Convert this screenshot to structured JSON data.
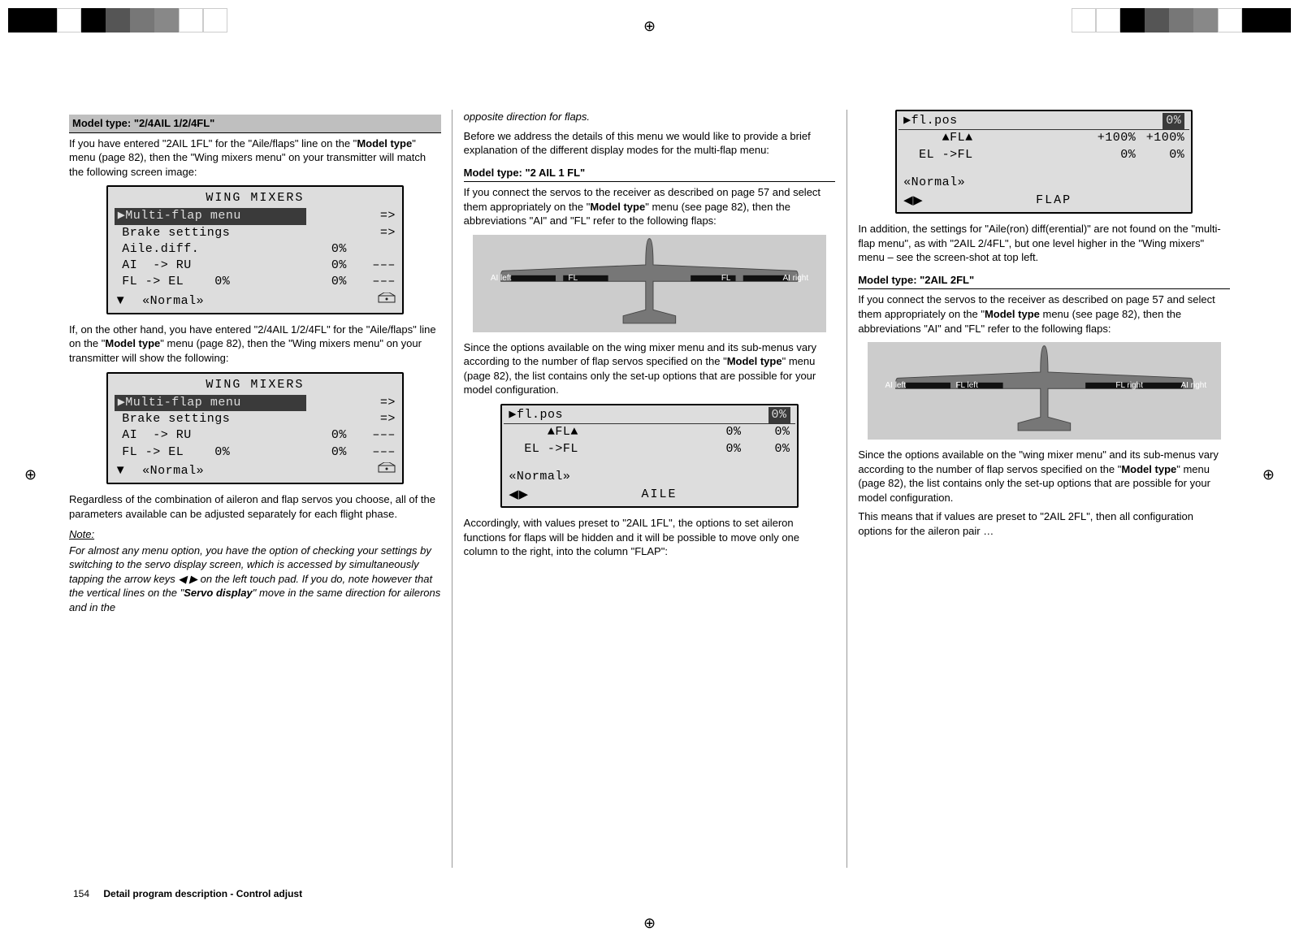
{
  "page_number": "154",
  "footer_text": "Detail program description - Control adjust",
  "col1": {
    "header_bg": "Model type: \"2/4AIL 1/2/4FL\"",
    "p1_a": "If you have entered \"2AIL 1FL\" for the \"Aile/flaps\" line on the \"",
    "p1_b": "Model type",
    "p1_c": "\" menu (page 82), then the \"Wing mixers menu\" on your transmitter will match the following screen image:",
    "lcd1_title": "WING  MIXERS",
    "lcd1_rows": [
      {
        "label": "▶Multi-flap menu",
        "c1": "",
        "c2": "=>"
      },
      {
        "label": " Brake settings",
        "c1": "",
        "c2": "=>"
      },
      {
        "label": " Aile.diff.",
        "c1": "0%",
        "c2": ""
      },
      {
        "label": " AI  -> RU",
        "c1": "0%",
        "c2": "–––"
      },
      {
        "label": " FL -> EL    0%",
        "c1": "0%",
        "c2": "–––"
      }
    ],
    "lcd1_footer_left": "▼",
    "lcd1_footer_mid": "«Normal»",
    "lcd1_footer_right_icon": "icon",
    "p2_a": "If, on the other hand, you have entered \"2/4AIL 1/2/4FL\" for the \"Aile/flaps\" line on the \"",
    "p2_b": "Model type",
    "p2_c": "\" menu (page 82), then the \"Wing mixers menu\" on your transmitter will show the following:",
    "lcd2_title": "WING  MIXERS",
    "lcd2_rows": [
      {
        "label": "▶Multi-flap menu",
        "c1": "",
        "c2": "=>"
      },
      {
        "label": " Brake settings",
        "c1": "",
        "c2": "=>"
      },
      {
        "label": " AI  -> RU",
        "c1": "0%",
        "c2": "–––"
      },
      {
        "label": " FL -> EL    0%",
        "c1": "0%",
        "c2": "–––"
      }
    ],
    "lcd2_footer_left": "▼",
    "lcd2_footer_mid": "«Normal»",
    "p3": "Regardless of the combination of aileron and flap servos you choose, all of the parameters available can be adjusted separately for each flight phase.",
    "note_hdr": "Note:",
    "note_a": "For almost any menu option, you have the option of checking your settings by switching to the servo display screen, which is accessed by simultaneously tapping the arrow keys ◀ ▶ on the left touch pad. If you do, note however that the vertical lines on the \"",
    "note_b": "Servo display",
    "note_c": "\" move in the same direction for ailerons and in the"
  },
  "col2": {
    "p0": "opposite direction for flaps.",
    "p1": "Before we address the details of this menu we would like to provide a brief explanation of the different display modes for the multi-flap menu:",
    "header_line_1": "Model type: \"2 AIL 1 FL\"",
    "p2_a": "If you connect the servos to the receiver as described on page 57 and select them appropriately on the \"",
    "p2_b": "Model type",
    "p2_c": "\" menu (see page 82), then the abbreviations \"AI\" and \"FL\" refer to the following flaps:",
    "wing1_labels": {
      "l1": "AI\nleft",
      "l2": "FL",
      "r1": "FL",
      "r2": "AI\nright"
    },
    "p3_a": "Since the options available on the wing mixer menu and its sub-menus vary according to the number of flap servos specified on the \"",
    "p3_b": "Model type",
    "p3_c": "\" menu (page 82), the list contains only the set-up options that are possible for your model configuration.",
    "lcd3_header_left": "▶fl.pos",
    "lcd3_header_right": "0%",
    "lcd3_rows": [
      {
        "label": "     ▲FL▲",
        "c1": "0%",
        "c2": "0%"
      },
      {
        "label": "  EL ->FL",
        "c1": "0%",
        "c2": "0%"
      }
    ],
    "lcd3_normal": "«Normal»",
    "lcd3_footer_left": "◀▶",
    "lcd3_footer_right": "AILE",
    "p4": "Accordingly, with values preset to \"2AIL 1FL\", the options to set aileron functions for flaps will be hidden and it will be possible to move only one column to the right, into the column \"FLAP\":"
  },
  "col3": {
    "lcd4_header_left": "▶fl.pos",
    "lcd4_header_right": "0%",
    "lcd4_rows": [
      {
        "label": "     ▲FL▲",
        "c1": "+100%",
        "c2": "+100%"
      },
      {
        "label": "  EL ->FL",
        "c1": "0%",
        "c2": "0%"
      }
    ],
    "lcd4_normal": "«Normal»",
    "lcd4_footer_left": "◀▶",
    "lcd4_footer_right": "FLAP",
    "p1": "In addition, the settings for \"Aile(ron) diff(erential)\" are not found on the \"multi-flap menu\", as with \"2AIL 2/4FL\", but one level higher in the \"Wing mixers\" menu – see the screen-shot at top left.",
    "header_line_2": "Model type: \"2AIL 2FL\"",
    "p2_a": "If you connect the servos to the receiver as described on page 57 and select them appropriately on the \"",
    "p2_b": "Model type",
    "p2_c": " menu (see page 82), then the abbreviations \"AI\" and \"FL\" refer to the following flaps:",
    "wing2_labels": {
      "l1": "AI\nleft",
      "l2": "FL\nleft",
      "r1": "FL\nright",
      "r2": "AI\nright"
    },
    "p3_a": "Since the options available on the \"wing mixer menu\" and its sub-menus vary according to the number of flap servos specified on the \"",
    "p3_b": "Model type",
    "p3_c": "\" menu (page 82), the list contains only the set-up options that are possible for your model configuration.",
    "p4": "This means that if values are preset to \"2AIL 2FL\", then all configuration options for the aileron pair …"
  }
}
